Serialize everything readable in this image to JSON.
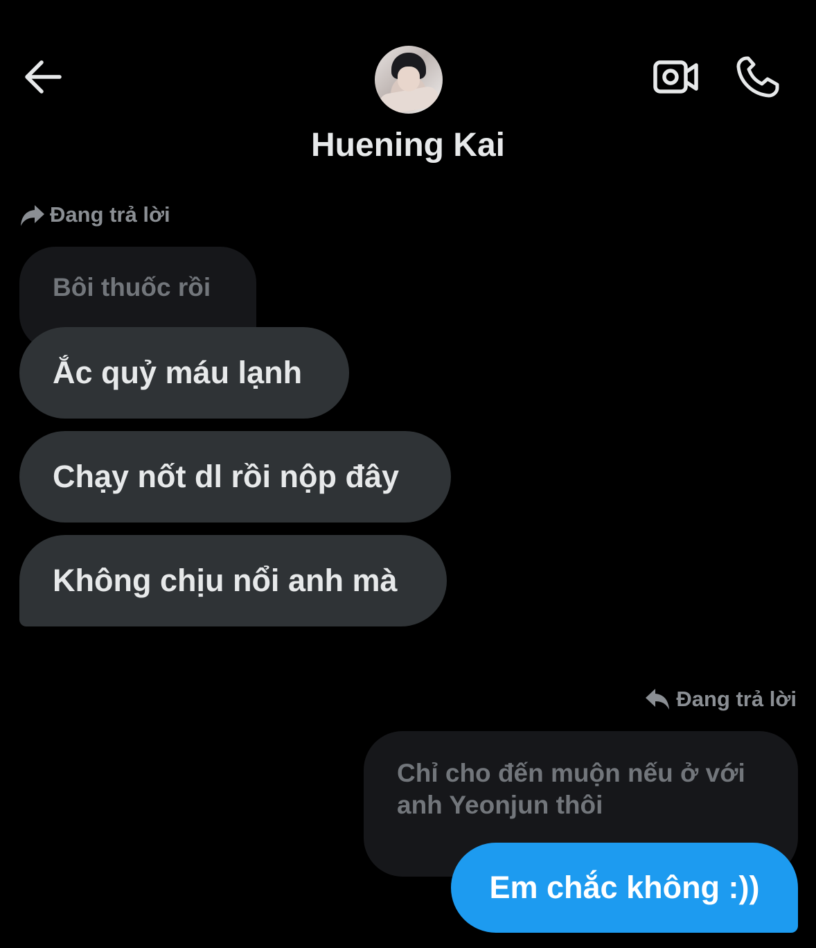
{
  "header": {
    "contact_name": "Huening Kai"
  },
  "icons": {
    "back": "arrow-left-icon",
    "video": "video-camera-icon",
    "call": "phone-icon",
    "reply_in": "reply-forward-icon",
    "reply_out": "reply-back-icon"
  },
  "colors": {
    "background": "#000000",
    "incoming_bubble": "#2f3336",
    "quoted_bubble": "#16171a",
    "outgoing_bubble": "#1d9bf0",
    "muted_text": "#8b8f94"
  },
  "messages": {
    "incoming_reply_label": "Đang trả lời",
    "incoming_quoted": "Bôi thuốc rồi",
    "incoming": [
      "Ắc quỷ máu lạnh",
      "Chạy nốt dl rồi nộp đây",
      "Không chịu nổi anh mà"
    ],
    "outgoing_reply_label": "Đang trả lời",
    "outgoing_quoted_line1": "Chỉ cho đến muộn nếu ở với",
    "outgoing_quoted_line2": "anh Yeonjun thôi",
    "outgoing": "Em chắc không :))"
  }
}
